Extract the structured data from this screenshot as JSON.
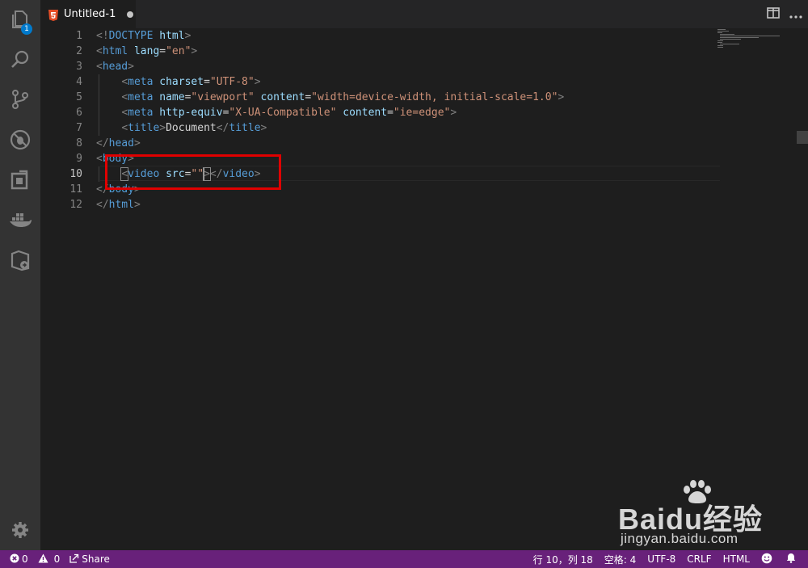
{
  "activity_bar": {
    "items": [
      {
        "name": "explorer",
        "icon": "files-icon",
        "badge": "1"
      },
      {
        "name": "search",
        "icon": "search-icon"
      },
      {
        "name": "source-control",
        "icon": "git-branch-icon"
      },
      {
        "name": "debug",
        "icon": "no-bug-icon"
      },
      {
        "name": "extensions",
        "icon": "extensions-icon"
      },
      {
        "name": "docker",
        "icon": "docker-icon"
      },
      {
        "name": "remote",
        "icon": "remote-icon"
      }
    ],
    "settings_icon": "gear-icon"
  },
  "tab": {
    "title": "Untitled-1",
    "icon": "html5-icon",
    "dirty": true,
    "icon_color": "#e44d26"
  },
  "editor_actions": [
    "split-editor-icon",
    "more-actions-icon"
  ],
  "editor": {
    "current_line": 10,
    "lines": [
      {
        "n": "1",
        "tokens": [
          [
            "br",
            "<!"
          ],
          [
            "tag",
            "DOCTYPE"
          ],
          [
            "tx",
            " "
          ],
          [
            "at",
            "html"
          ],
          [
            "br",
            ">"
          ]
        ]
      },
      {
        "n": "2",
        "tokens": [
          [
            "br",
            "<"
          ],
          [
            "tag",
            "html"
          ],
          [
            "tx",
            " "
          ],
          [
            "at",
            "lang"
          ],
          [
            "tx",
            "="
          ],
          [
            "st",
            "\"en\""
          ],
          [
            "br",
            ">"
          ]
        ]
      },
      {
        "n": "3",
        "tokens": [
          [
            "br",
            "<"
          ],
          [
            "tag",
            "head"
          ],
          [
            "br",
            ">"
          ]
        ]
      },
      {
        "n": "4",
        "tokens": [
          [
            "tx",
            "    "
          ],
          [
            "br",
            "<"
          ],
          [
            "tag",
            "meta"
          ],
          [
            "tx",
            " "
          ],
          [
            "at",
            "charset"
          ],
          [
            "tx",
            "="
          ],
          [
            "st",
            "\"UTF-8\""
          ],
          [
            "br",
            ">"
          ]
        ]
      },
      {
        "n": "5",
        "tokens": [
          [
            "tx",
            "    "
          ],
          [
            "br",
            "<"
          ],
          [
            "tag",
            "meta"
          ],
          [
            "tx",
            " "
          ],
          [
            "at",
            "name"
          ],
          [
            "tx",
            "="
          ],
          [
            "st",
            "\"viewport\""
          ],
          [
            "tx",
            " "
          ],
          [
            "at",
            "content"
          ],
          [
            "tx",
            "="
          ],
          [
            "st",
            "\"width=device-width, initial-scale=1.0\""
          ],
          [
            "br",
            ">"
          ]
        ]
      },
      {
        "n": "6",
        "tokens": [
          [
            "tx",
            "    "
          ],
          [
            "br",
            "<"
          ],
          [
            "tag",
            "meta"
          ],
          [
            "tx",
            " "
          ],
          [
            "at",
            "http-equiv"
          ],
          [
            "tx",
            "="
          ],
          [
            "st",
            "\"X-UA-Compatible\""
          ],
          [
            "tx",
            " "
          ],
          [
            "at",
            "content"
          ],
          [
            "tx",
            "="
          ],
          [
            "st",
            "\"ie=edge\""
          ],
          [
            "br",
            ">"
          ]
        ]
      },
      {
        "n": "7",
        "tokens": [
          [
            "tx",
            "    "
          ],
          [
            "br",
            "<"
          ],
          [
            "tag",
            "title"
          ],
          [
            "br",
            ">"
          ],
          [
            "tx",
            "Document"
          ],
          [
            "br",
            "</"
          ],
          [
            "tag",
            "title"
          ],
          [
            "br",
            ">"
          ]
        ]
      },
      {
        "n": "8",
        "tokens": [
          [
            "br",
            "</"
          ],
          [
            "tag",
            "head"
          ],
          [
            "br",
            ">"
          ]
        ]
      },
      {
        "n": "9",
        "tokens": [
          [
            "br",
            "<"
          ],
          [
            "tag",
            "body"
          ],
          [
            "br",
            ">"
          ]
        ]
      },
      {
        "n": "10",
        "tokens": [
          [
            "tx",
            "    "
          ],
          [
            "brbox",
            "<"
          ],
          [
            "tag",
            "video"
          ],
          [
            "tx",
            " "
          ],
          [
            "at",
            "src"
          ],
          [
            "tx",
            "="
          ],
          [
            "st",
            "\"\""
          ],
          [
            "caret",
            ""
          ],
          [
            "brbox",
            ">"
          ],
          [
            "br",
            "</"
          ],
          [
            "tag",
            "video"
          ],
          [
            "br",
            ">"
          ]
        ]
      },
      {
        "n": "11",
        "tokens": [
          [
            "br",
            "</"
          ],
          [
            "tag",
            "body"
          ],
          [
            "br",
            ">"
          ]
        ]
      },
      {
        "n": "12",
        "tokens": [
          [
            "br",
            "</"
          ],
          [
            "tag",
            "html"
          ],
          [
            "br",
            ">"
          ]
        ]
      }
    ]
  },
  "status_bar": {
    "color": "#68217a",
    "errors": "0",
    "warnings": "0",
    "share_label": "Share",
    "position": "行 10，列 18",
    "indent": "空格: 4",
    "encoding": "UTF-8",
    "eol": "CRLF",
    "language": "HTML"
  },
  "watermark": {
    "main": "Baidu经验",
    "sub": "jingyan.baidu.com"
  }
}
